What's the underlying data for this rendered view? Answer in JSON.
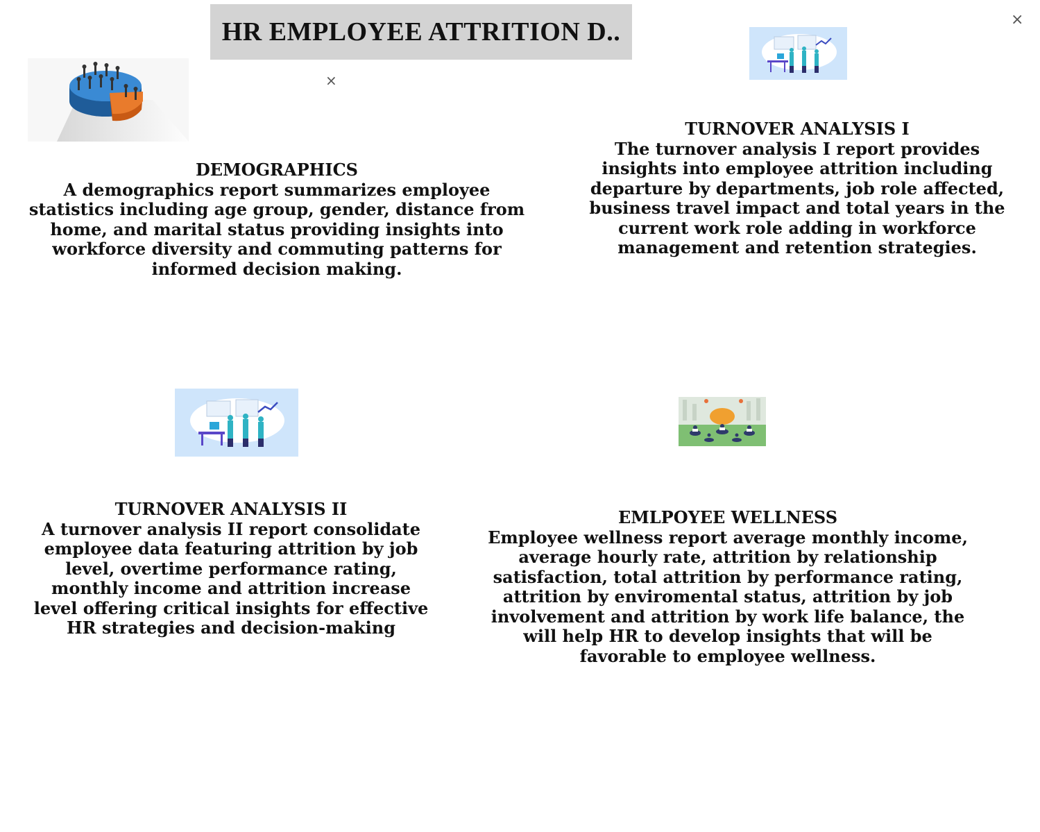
{
  "header": {
    "title": "HR EMPLOYEE ATTRITION D..",
    "title_bg": "#d3d3d3"
  },
  "close_glyph": "×",
  "images": {
    "demographics": "pie-chart-people-icon",
    "turnover1": "team-analytics-illustration",
    "turnover2": "team-analytics-illustration",
    "wellness": "meditation-wellness-illustration"
  },
  "sections": {
    "demographics": {
      "heading": "DEMOGRAPHICS",
      "body": "A demographics report summarizes employee statistics including age group, gender, distance from home, and marital status providing insights into workforce diversity and commuting patterns for informed decision making."
    },
    "turnover1": {
      "heading": "TURNOVER ANALYSIS I",
      "body": "The turnover analysis I report provides insights into employee attrition including departure by departments, job role affected, business travel impact and total years in the current work role adding in workforce management and retention strategies."
    },
    "turnover2": {
      "heading": "TURNOVER ANALYSIS II",
      "body": "A turnover analysis II report consolidate employee data featuring attrition by job level, overtime performance rating, monthly income and attrition increase level offering critical insights for effective HR strategies and decision-making"
    },
    "wellness": {
      "heading": "EMLPOYEE WELLNESS",
      "body": "Employee wellness report average monthly income, average hourly rate, attrition by relationship satisfaction, total attrition by performance rating, attrition by enviromental status, attrition by job involvement and attrition by work life balance, the will help HR to develop insights that will be favorable to employee wellness."
    }
  }
}
